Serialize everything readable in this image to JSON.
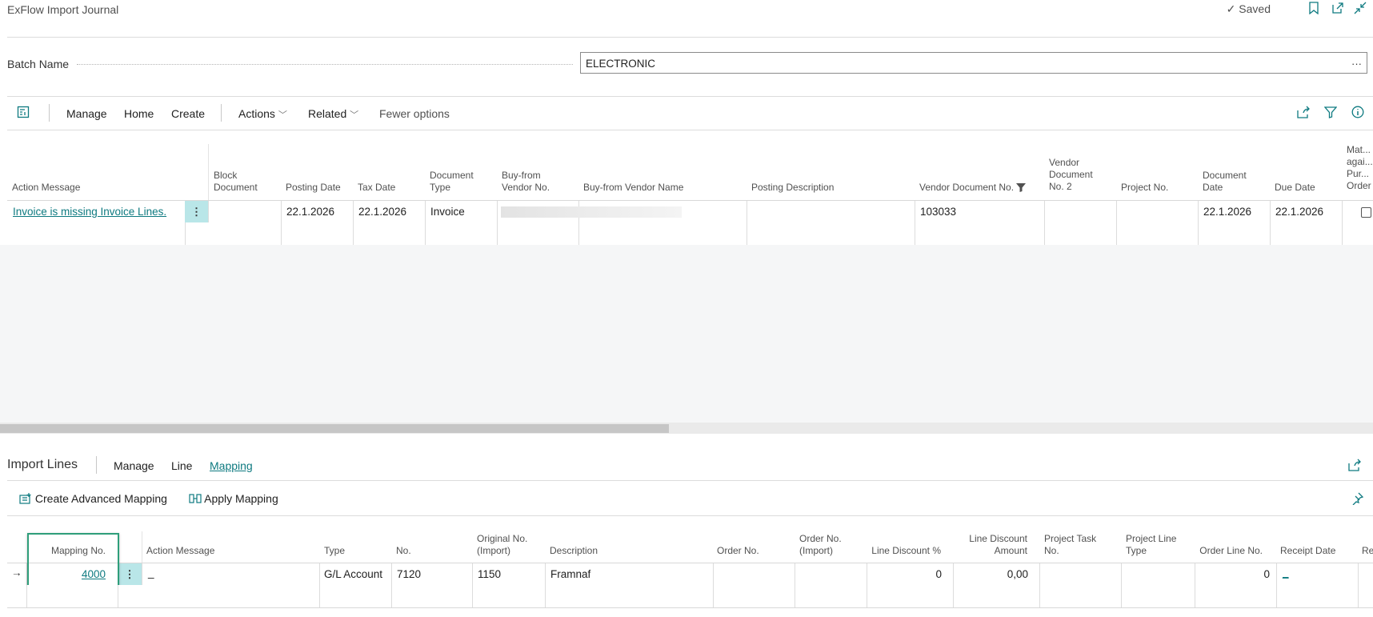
{
  "window": {
    "title": "ExFlow Import Journal",
    "saved_label": "Saved"
  },
  "batch": {
    "label": "Batch Name",
    "value": "ELECTRONIC",
    "ellipsis": "···"
  },
  "actionbar": {
    "items": [
      "Manage",
      "Home",
      "Create",
      "Actions",
      "Related",
      "Fewer options"
    ]
  },
  "journal": {
    "headers": {
      "action_message": "Action Message",
      "block_document": "Block Document",
      "posting_date": "Posting Date",
      "tax_date": "Tax Date",
      "document_type": "Document Type",
      "buy_from_vendor_no": "Buy-from Vendor No.",
      "buy_from_vendor_name": "Buy-from Vendor Name",
      "posting_description": "Posting Description",
      "vendor_document_no": "Vendor Document No.",
      "vendor_document_no2": "Vendor Document No. 2",
      "project_no": "Project No.",
      "document_date": "Document Date",
      "due_date": "Due Date",
      "matched": "Mat... agai... Pur... Order"
    },
    "row": {
      "action_message": "Invoice is missing Invoice Lines.",
      "posting_date": "22.1.2026",
      "tax_date": "22.1.2026",
      "document_type": "Invoice",
      "vendor_document_no": "103033",
      "document_date": "22.1.2026",
      "due_date": "22.1.2026",
      "matched": false
    }
  },
  "import_lines": {
    "title": "Import Lines",
    "tabs": [
      "Manage",
      "Line",
      "Mapping"
    ],
    "active_tab": "Mapping",
    "actions": {
      "create_advanced_mapping": "Create Advanced Mapping",
      "apply_mapping": "Apply Mapping"
    },
    "headers": {
      "mapping_no": "Mapping No.",
      "action_message": "Action Message",
      "type": "Type",
      "no": "No.",
      "original_no": "Original No. (Import)",
      "description": "Description",
      "order_no": "Order No.",
      "order_no_import": "Order No. (Import)",
      "line_discount_pct": "Line Discount %",
      "line_discount_amount": "Line Discount Amount",
      "project_task_no": "Project Task No.",
      "project_line_type": "Project Line Type",
      "order_line_no": "Order Line No.",
      "receipt_date": "Receipt Date",
      "re": "Re"
    },
    "row": {
      "mapping_no": "4000",
      "action_message": "_",
      "type": "G/L Account",
      "no": "7120",
      "original_no": "1150",
      "description": "Framnaf",
      "line_discount_pct": "0",
      "line_discount_amount": "0,00",
      "order_line_no": "0",
      "receipt_date": "_"
    }
  },
  "colors": {
    "accent": "#0e7a80",
    "highlight": "#b9e6e8",
    "focus_border": "#2e9e7a"
  }
}
